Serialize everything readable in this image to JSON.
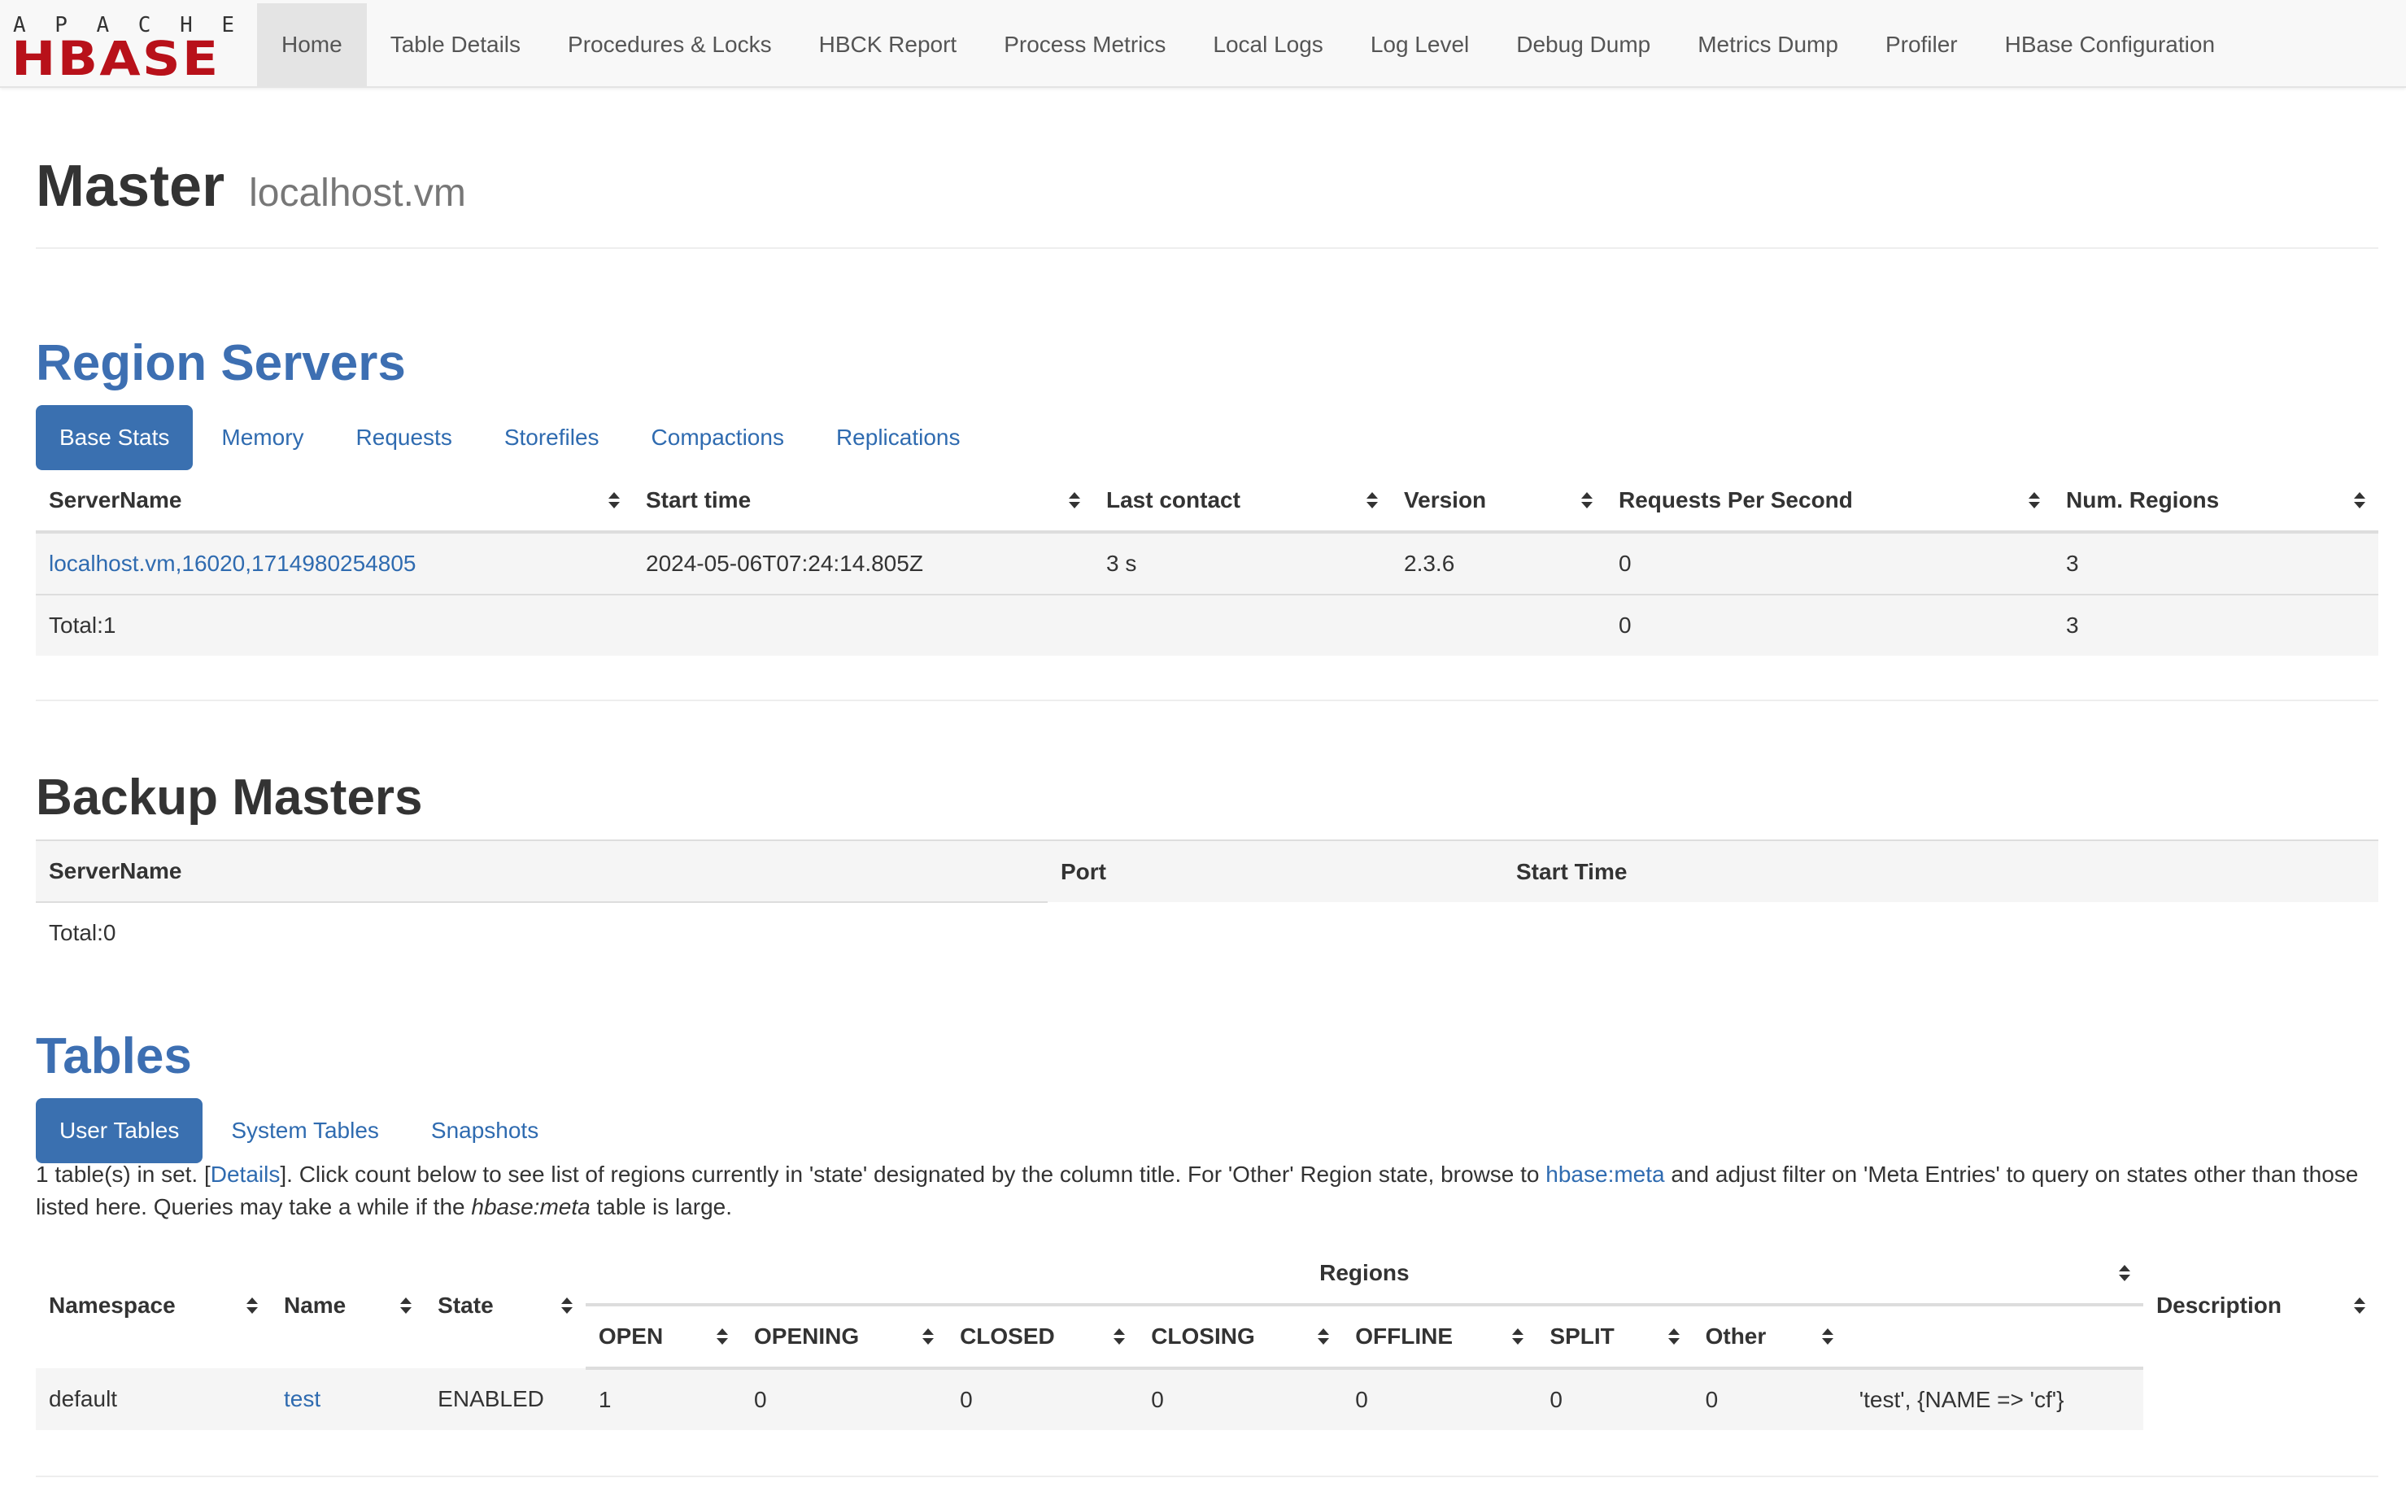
{
  "brand": {
    "apache": "APACHE",
    "hbase": "HBASE",
    "color": "#b8111a"
  },
  "nav": {
    "items": [
      "Home",
      "Table Details",
      "Procedures & Locks",
      "HBCK Report",
      "Process Metrics",
      "Local Logs",
      "Log Level",
      "Debug Dump",
      "Metrics Dump",
      "Profiler",
      "HBase Configuration"
    ],
    "active": "Home"
  },
  "header": {
    "title": "Master",
    "host": "localhost.vm"
  },
  "region_servers": {
    "heading": "Region Servers",
    "tabs": [
      "Base Stats",
      "Memory",
      "Requests",
      "Storefiles",
      "Compactions",
      "Replications"
    ],
    "active_tab": "Base Stats",
    "columns": [
      "ServerName",
      "Start time",
      "Last contact",
      "Version",
      "Requests Per Second",
      "Num. Regions"
    ],
    "rows": [
      [
        "localhost.vm,16020,1714980254805",
        "2024-05-06T07:24:14.805Z",
        "3 s",
        "2.3.6",
        "0",
        "3"
      ]
    ],
    "total": {
      "label": "Total:1",
      "requests": "0",
      "regions": "3"
    }
  },
  "backup_masters": {
    "heading": "Backup Masters",
    "columns": [
      "ServerName",
      "Port",
      "Start Time"
    ],
    "total": "Total:0"
  },
  "tables": {
    "heading": "Tables",
    "tabs": [
      "User Tables",
      "System Tables",
      "Snapshots"
    ],
    "active_tab": "User Tables",
    "note": {
      "p1": "1 table(s) in set. [",
      "details_link": "Details",
      "p2": "]. Click count below to see list of regions currently in 'state' designated by the column title. For 'Other' Region state, browse to ",
      "meta_link": "hbase:meta",
      "p3": " and adjust filter on 'Meta Entries' to query on states other than those listed here. Queries may take a while if the ",
      "meta_italic": "hbase:meta",
      "p4": " table is large."
    },
    "columns": {
      "namespace": "Namespace",
      "name": "Name",
      "state": "State",
      "regions": "Regions",
      "description": "Description",
      "region_states": [
        "OPEN",
        "OPENING",
        "CLOSED",
        "CLOSING",
        "OFFLINE",
        "SPLIT",
        "Other"
      ]
    },
    "rows": [
      {
        "namespace": "default",
        "name": "test",
        "state": "ENABLED",
        "counts": [
          "1",
          "0",
          "0",
          "0",
          "0",
          "0",
          "0"
        ],
        "description": "'test', {NAME => 'cf'}"
      }
    ]
  },
  "colors": {
    "link": "#2f6bb0",
    "heading_blue": "#3d6fb2",
    "pill_active": "#3a70b0"
  }
}
